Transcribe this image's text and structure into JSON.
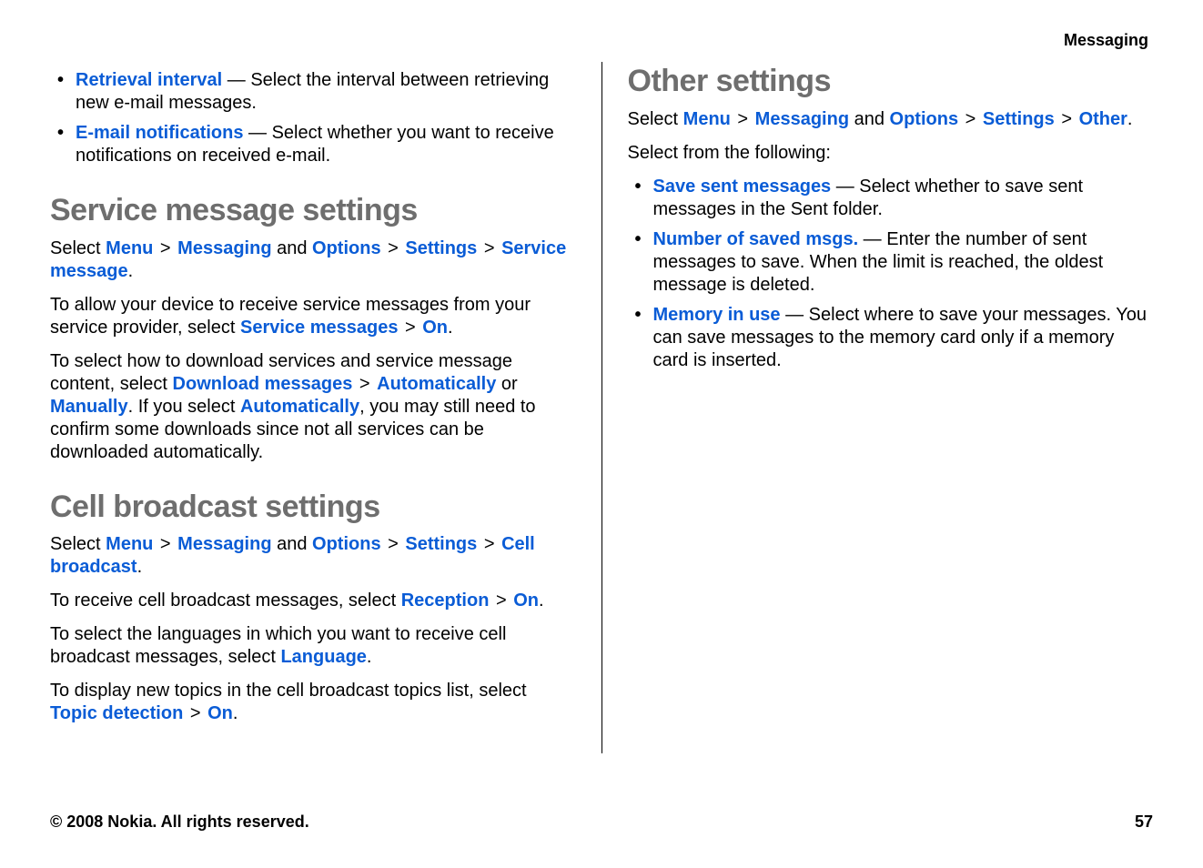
{
  "header": {
    "section": "Messaging"
  },
  "left": {
    "intro_bullets": [
      {
        "link": "Retrieval interval",
        "rest": " — Select the interval between retrieving new e-mail messages."
      },
      {
        "link": "E-mail notifications",
        "rest": " — Select whether you want to receive notifications on received e-mail."
      }
    ],
    "service": {
      "heading": "Service message settings",
      "select_prefix": "Select ",
      "path": {
        "menu": "Menu",
        "gt1": " > ",
        "messaging": "Messaging",
        "and": " and ",
        "options": "Options",
        "gt2": " > ",
        "settings": "Settings",
        "gt3": " > ",
        "last": "Service message",
        "period": "."
      },
      "p2_a": "To allow your device to receive service messages from your service provider, select ",
      "p2_link1": "Service messages",
      "p2_gt": " > ",
      "p2_link2": "On",
      "p2_end": ".",
      "p3_a": "To select how to download services and service message content, select ",
      "p3_link1": "Download messages",
      "p3_gt": " > ",
      "p3_link2": "Automatically",
      "p3_or": " or ",
      "p3_link3": "Manually",
      "p3_b": ". If you select ",
      "p3_link4": "Automatically",
      "p3_c": ", you may still need to confirm some downloads since not all services can be downloaded automatically."
    },
    "cell": {
      "heading": "Cell broadcast settings",
      "select_prefix": "Select ",
      "path": {
        "menu": "Menu",
        "gt1": " > ",
        "messaging": "Messaging",
        "and": " and ",
        "options": "Options",
        "gt2": " > ",
        "settings": "Settings",
        "gt3": " > ",
        "last": "Cell broadcast",
        "period": "."
      },
      "p2_a": "To receive cell broadcast messages, select ",
      "p2_link1": "Reception",
      "p2_gt": " > ",
      "p2_link2": "On",
      "p2_end": ".",
      "p3_a": "To select the languages in which you want to receive cell broadcast messages, select ",
      "p3_link1": "Language",
      "p3_end": ".",
      "p4_a": "To display new topics in the cell broadcast topics list, select ",
      "p4_link1": "Topic detection",
      "p4_gt": " > ",
      "p4_link2": "On",
      "p4_end": "."
    }
  },
  "right": {
    "other": {
      "heading": "Other settings",
      "select_prefix": "Select ",
      "path": {
        "menu": "Menu",
        "gt1": " > ",
        "messaging": "Messaging",
        "and": " and ",
        "options": "Options",
        "gt2": " > ",
        "settings": "Settings",
        "gt3": " > ",
        "last": "Other",
        "period": "."
      },
      "select_from": "Select from the following:",
      "bullets": [
        {
          "link": "Save sent messages",
          "rest": " — Select whether to save sent messages in the Sent folder."
        },
        {
          "link": "Number of saved msgs.",
          "rest": " — Enter the number of sent messages to save. When the limit is reached, the oldest message is deleted."
        },
        {
          "link": "Memory in use",
          "rest": " — Select where to save your messages. You can save messages to the memory card only if a memory card is inserted."
        }
      ]
    }
  },
  "footer": {
    "copyright": "© 2008 Nokia. All rights reserved.",
    "page": "57"
  }
}
